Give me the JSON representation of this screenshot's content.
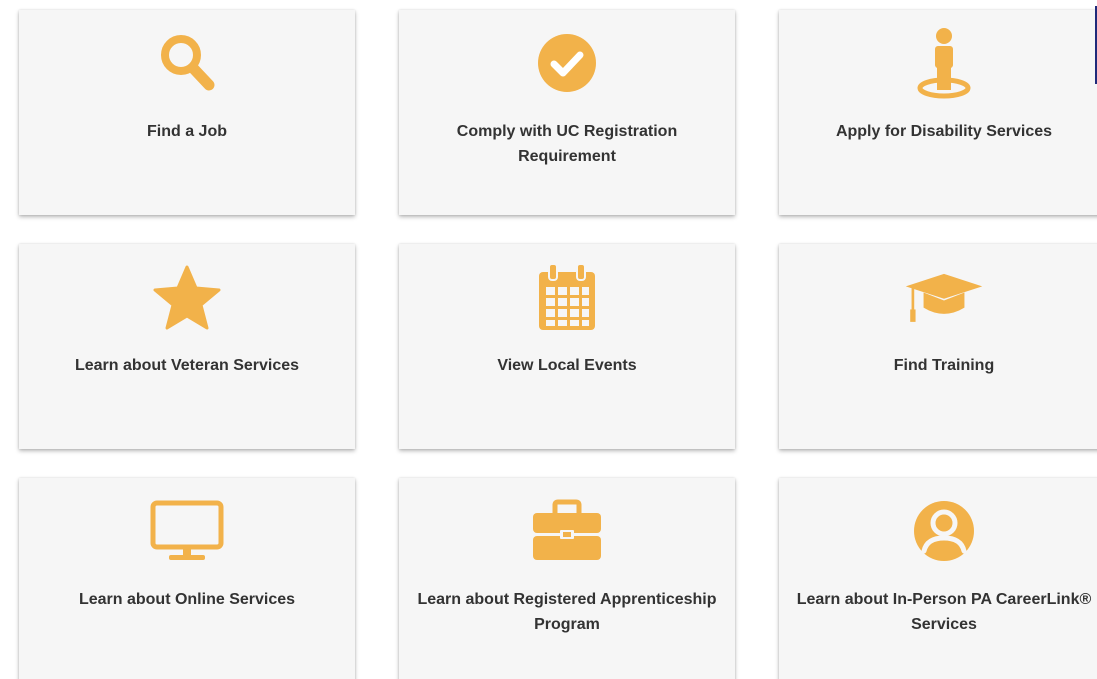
{
  "accent_color": "#f2b24a",
  "tiles": [
    {
      "label": "Find a Job",
      "icon": "search-icon"
    },
    {
      "label": "Comply with UC Registration Requirement",
      "icon": "check-circle-icon"
    },
    {
      "label": "Apply for Disability Services",
      "icon": "person-standing-icon"
    },
    {
      "label": "Learn about Veteran Services",
      "icon": "star-icon"
    },
    {
      "label": "View Local Events",
      "icon": "calendar-icon"
    },
    {
      "label": "Find Training",
      "icon": "graduation-cap-icon"
    },
    {
      "label": "Learn about Online Services",
      "icon": "monitor-icon"
    },
    {
      "label": "Learn about Registered Apprenticeship Program",
      "icon": "briefcase-icon"
    },
    {
      "label": "Learn about In-Person PA CareerLink® Services",
      "icon": "user-circle-icon"
    }
  ]
}
